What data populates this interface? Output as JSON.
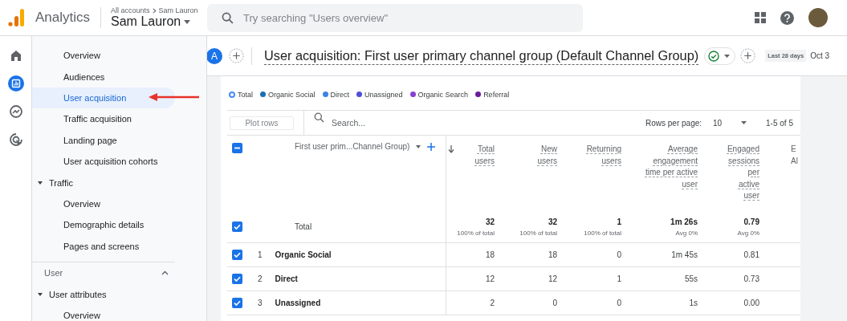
{
  "topbar": {
    "product": "Analytics",
    "breadcrumb": [
      "All accounts",
      "Sam Lauron"
    ],
    "account": "Sam Lauron",
    "search": {
      "placeholder": "Try searching \"Users overview\""
    }
  },
  "rail": {
    "items": [
      {
        "kind": "home",
        "selected": false
      },
      {
        "kind": "reports",
        "selected": true
      },
      {
        "kind": "explore",
        "selected": false
      },
      {
        "kind": "advertising",
        "selected": false
      }
    ]
  },
  "sidebar": {
    "items": [
      {
        "kind": "link",
        "label": "Overview",
        "selected": false
      },
      {
        "kind": "link",
        "label": "Audiences",
        "selected": false
      },
      {
        "kind": "link",
        "label": "User acquisition",
        "selected": true
      },
      {
        "kind": "link",
        "label": "Traffic acquisition",
        "selected": false
      },
      {
        "kind": "link",
        "label": "Landing page",
        "selected": false
      },
      {
        "kind": "link",
        "label": "User acquisition cohorts",
        "selected": false
      },
      {
        "kind": "group",
        "label": "Traffic",
        "expanded": true,
        "children": [
          {
            "kind": "link",
            "label": "Overview",
            "selected": false
          },
          {
            "kind": "link",
            "label": "Demographic details",
            "selected": false
          },
          {
            "kind": "link",
            "label": "Pages and screens",
            "selected": false
          }
        ]
      },
      {
        "kind": "section",
        "label": "User",
        "expanded": true
      },
      {
        "kind": "group",
        "label": "User attributes",
        "expanded": true,
        "children": [
          {
            "kind": "link",
            "label": "Overview",
            "selected": false
          }
        ]
      }
    ]
  },
  "header": {
    "comparison": "A",
    "title": "User acquisition: First user primary channel group (Default Channel Group)",
    "date_label": "Last 28 days",
    "date_range": "Oct 3"
  },
  "legend": {
    "items": [
      {
        "kind": "ring",
        "label": "Total",
        "color": "#4a8af4"
      },
      {
        "kind": "dot",
        "label": "Organic Social",
        "color": "#1a6fb5"
      },
      {
        "kind": "dot",
        "label": "Direct",
        "color": "#3b82e8"
      },
      {
        "kind": "dot",
        "label": "Unassigned",
        "color": "#4e4fd8"
      },
      {
        "kind": "dot",
        "label": "Organic Search",
        "color": "#8a3fd1"
      },
      {
        "kind": "dot",
        "label": "Referral",
        "color": "#6a1b9a"
      }
    ]
  },
  "toolbar": {
    "plot_button": "Plot rows",
    "plot_disabled": true,
    "search": {
      "placeholder": "Search..."
    },
    "rows_per_page_label": "Rows per page:",
    "rows_per_page": "10",
    "pagination": "1-5 of 5"
  },
  "table": {
    "header_indeterminate": true,
    "dimension": "First user prim...Channel Group)",
    "columns": [
      {
        "label": "Total users",
        "sorted": true
      },
      {
        "label": "New users",
        "sorted": false
      },
      {
        "label": "Returning users",
        "sorted": false
      },
      {
        "label": "Average engagement time per active user",
        "sorted": false
      },
      {
        "label": "Engaged sessions per active user",
        "sorted": false
      },
      {
        "label": "E Al",
        "sorted": false
      }
    ],
    "total": {
      "checked": true,
      "label": "Total",
      "values": [
        {
          "value": "32",
          "note": "100% of total"
        },
        {
          "value": "32",
          "note": "100% of total"
        },
        {
          "value": "1",
          "note": "100% of total"
        },
        {
          "value": "1m 26s",
          "note": "Avg 0%"
        },
        {
          "value": "0.79",
          "note": "Avg 0%"
        }
      ]
    },
    "rows": [
      {
        "checked": true,
        "index": "1",
        "name": "Organic Social",
        "values": [
          "18",
          "18",
          "0",
          "1m 45s",
          "0.81"
        ]
      },
      {
        "checked": true,
        "index": "2",
        "name": "Direct",
        "values": [
          "12",
          "12",
          "1",
          "55s",
          "0.73"
        ]
      },
      {
        "checked": true,
        "index": "3",
        "name": "Unassigned",
        "values": [
          "2",
          "0",
          "0",
          "1s",
          "0.00"
        ]
      }
    ]
  }
}
